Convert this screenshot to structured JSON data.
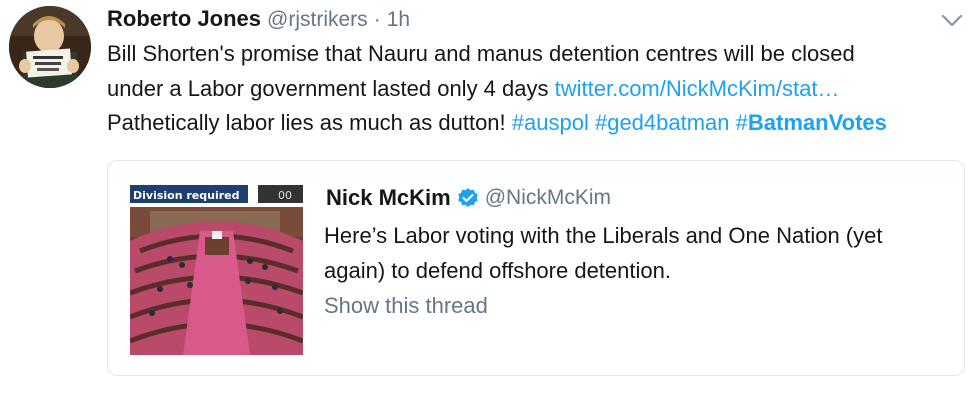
{
  "tweet": {
    "author_name": "Roberto Jones",
    "author_handle": "@rjstrikers",
    "separator": "·",
    "time": "1h",
    "text_line1": "Bill Shorten's promise that Nauru and manus detention centres will be closed",
    "text_line2_prefix": "under a Labor government lasted only 4 days ",
    "link": "twitter.com/NickMcKim/stat…",
    "text_line3_prefix": "Pathetically labor lies as much as dutton! ",
    "hashtag1": "#auspol",
    "hashtag2": "#ged4batman",
    "hashtag3_prefix": "#",
    "hashtag3_bold": "BatmanVotes"
  },
  "quoted_tweet": {
    "author_name": "Nick McKim",
    "author_handle": "@NickMcKim",
    "text_line1": "Here’s Labor voting with the Liberals and One Nation (yet",
    "text_line2": "again) to defend offshore detention.",
    "show_thread": "Show this thread",
    "thumbnail_caption": "Division required",
    "thumbnail_counter": "00"
  },
  "colors": {
    "link": "#1da1f2",
    "muted": "#657786",
    "text": "#14171a",
    "border": "#e1e8ed"
  },
  "icons": {
    "caret": "chevron-down-icon",
    "verified": "verified-badge-icon"
  }
}
